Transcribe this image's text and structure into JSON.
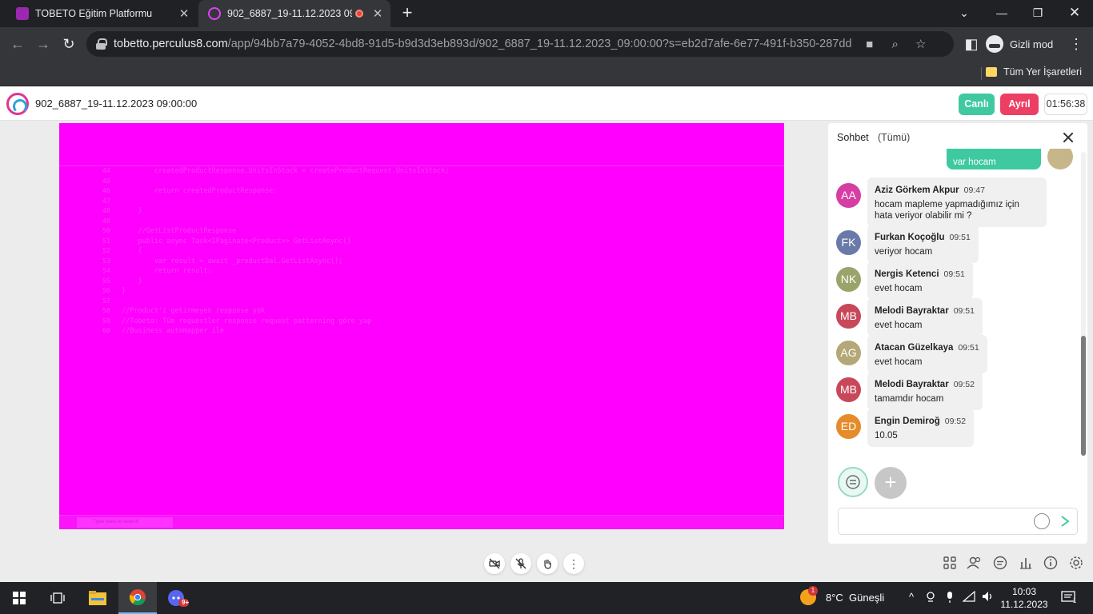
{
  "browser": {
    "tabs": [
      {
        "title": "TOBETO Eğitim Platformu"
      },
      {
        "title": "902_6887_19-11.12.2023 09"
      }
    ],
    "url_host": "tobetto.perculus8.com",
    "url_path": "/app/94bb7a79-4052-4bd8-91d5-b9d3d3eb893d/902_6887_19-11.12.2023_09:00:00?s=eb2d7afe-6e77-491f-b350-287dddd5a2d...",
    "incognito_label": "Gizli mod",
    "bookmarks_label": "Tüm Yer İşaretleri"
  },
  "app": {
    "session_title": "902_6887_19-11.12.2023 09:00:00",
    "live_label": "Canlı",
    "leave_label": "Ayrıl",
    "timer": "01:56:38"
  },
  "shared_screen": {
    "code_lines": [
      {
        "ln": "44",
        "text": "        createdProductResponse.UnitsInStock = createProductRequest.UnitsInStock;"
      },
      {
        "ln": "45",
        "text": ""
      },
      {
        "ln": "46",
        "text": "        return createdProductResponse;"
      },
      {
        "ln": "47",
        "text": ""
      },
      {
        "ln": "48",
        "text": "    }"
      },
      {
        "ln": "49",
        "text": ""
      },
      {
        "ln": "50",
        "text": "    //GetListProductResponse"
      },
      {
        "ln": "51",
        "text": "    public async Task<IPaginate<Product>> GetListAsync()"
      },
      {
        "ln": "52",
        "text": "    {"
      },
      {
        "ln": "53",
        "text": "        var result = await _productDal.GetListAsync();"
      },
      {
        "ln": "54",
        "text": "        return result;"
      },
      {
        "ln": "55",
        "text": "    }"
      },
      {
        "ln": "56",
        "text": "}"
      },
      {
        "ln": "57",
        "text": ""
      },
      {
        "ln": "58",
        "text": "//Product'i getirmeyen response yok"
      },
      {
        "ln": "59",
        "text": "//Tobeto: Tüm requestler response request patterning göre yap"
      },
      {
        "ln": "60",
        "text": "//Business automapper ile"
      }
    ],
    "taskbar_search": "Type here to search"
  },
  "chat": {
    "title": "Sohbet",
    "filter": "(Tümü)",
    "own_message": "var hocam",
    "messages": [
      {
        "initials": "AA",
        "sender": "Aziz Görkem Akpur",
        "time": "09:47",
        "text": "hocam mapleme yapmadığımız için hata veriyor olabilir mi ?",
        "color": "#d63ea3"
      },
      {
        "initials": "FK",
        "sender": "Furkan Koçoğlu",
        "time": "09:51",
        "text": "veriyor hocam",
        "color": "#6a7aa8"
      },
      {
        "initials": "NK",
        "sender": "Nergis Ketenci",
        "time": "09:51",
        "text": "evet hocam",
        "color": "#9aa46a"
      },
      {
        "initials": "MB",
        "sender": "Melodi Bayraktar",
        "time": "09:51",
        "text": "evet hocam",
        "color": "#c8485a"
      },
      {
        "initials": "AG",
        "sender": "Atacan Güzelkaya",
        "time": "09:51",
        "text": "evet hocam",
        "color": "#b4a878"
      },
      {
        "initials": "MB",
        "sender": "Melodi Bayraktar",
        "time": "09:52",
        "text": "tamamdır hocam",
        "color": "#c8485a"
      },
      {
        "initials": "ED",
        "sender": "Engin Demiroğ",
        "time": "09:52",
        "text": "10.05",
        "color": "#e58b2c"
      }
    ],
    "input_placeholder": ""
  },
  "taskbar": {
    "weather": "8°C  Güneşli",
    "weather_badge": "1",
    "time": "10:03",
    "date": "11.12.2023",
    "notification_count": "1",
    "discord_badge": "9+"
  }
}
